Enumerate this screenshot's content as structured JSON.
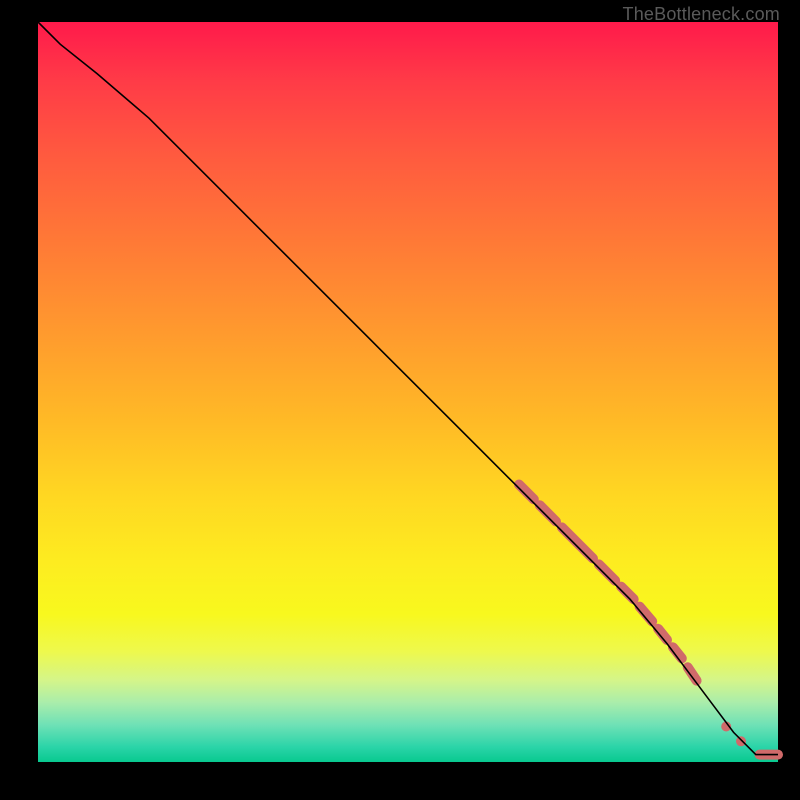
{
  "watermark": "TheBottleneck.com",
  "chart_data": {
    "type": "line",
    "title": "",
    "xlabel": "",
    "ylabel": "",
    "xlim": [
      0,
      100
    ],
    "ylim": [
      0,
      100
    ],
    "grid": false,
    "legend": false,
    "series": [
      {
        "name": "curve",
        "x": [
          0,
          3,
          8,
          15,
          25,
          35,
          45,
          55,
          60,
          65,
          70,
          75,
          80,
          85,
          88,
          91,
          94,
          97,
          100
        ],
        "y": [
          100,
          97,
          93,
          87,
          77,
          67,
          57,
          47,
          42,
          37,
          32,
          27,
          22,
          16,
          12,
          8,
          4,
          1,
          1
        ],
        "stroke": "#000000",
        "stroke_width": 1.6
      }
    ],
    "markers": [
      {
        "type": "segment",
        "x0": 65.0,
        "y0": 37.5,
        "x1": 67.0,
        "y1": 35.5,
        "color": "#d06a6a",
        "width": 10
      },
      {
        "type": "segment",
        "x0": 67.8,
        "y0": 34.7,
        "x1": 70.0,
        "y1": 32.5,
        "color": "#d06a6a",
        "width": 10
      },
      {
        "type": "segment",
        "x0": 70.8,
        "y0": 31.7,
        "x1": 75.0,
        "y1": 27.5,
        "color": "#d06a6a",
        "width": 10
      },
      {
        "type": "segment",
        "x0": 75.8,
        "y0": 26.7,
        "x1": 78.0,
        "y1": 24.5,
        "color": "#d06a6a",
        "width": 10
      },
      {
        "type": "segment",
        "x0": 78.8,
        "y0": 23.7,
        "x1": 80.5,
        "y1": 22.0,
        "color": "#d06a6a",
        "width": 10
      },
      {
        "type": "segment",
        "x0": 81.3,
        "y0": 21.0,
        "x1": 83.0,
        "y1": 19.0,
        "color": "#d06a6a",
        "width": 10
      },
      {
        "type": "segment",
        "x0": 83.8,
        "y0": 18.0,
        "x1": 85.0,
        "y1": 16.5,
        "color": "#d06a6a",
        "width": 10
      },
      {
        "type": "segment",
        "x0": 85.8,
        "y0": 15.5,
        "x1": 87.0,
        "y1": 14.0,
        "color": "#d06a6a",
        "width": 10
      },
      {
        "type": "segment",
        "x0": 87.8,
        "y0": 12.8,
        "x1": 89.0,
        "y1": 11.0,
        "color": "#d06a6a",
        "width": 10
      },
      {
        "type": "dot",
        "x": 93.0,
        "y": 4.8,
        "r": 5,
        "color": "#d06a6a"
      },
      {
        "type": "dot",
        "x": 95.0,
        "y": 2.8,
        "r": 5,
        "color": "#d06a6a"
      },
      {
        "type": "segment",
        "x0": 97.5,
        "y0": 1.0,
        "x1": 100.0,
        "y1": 1.0,
        "color": "#d06a6a",
        "width": 10
      }
    ]
  }
}
